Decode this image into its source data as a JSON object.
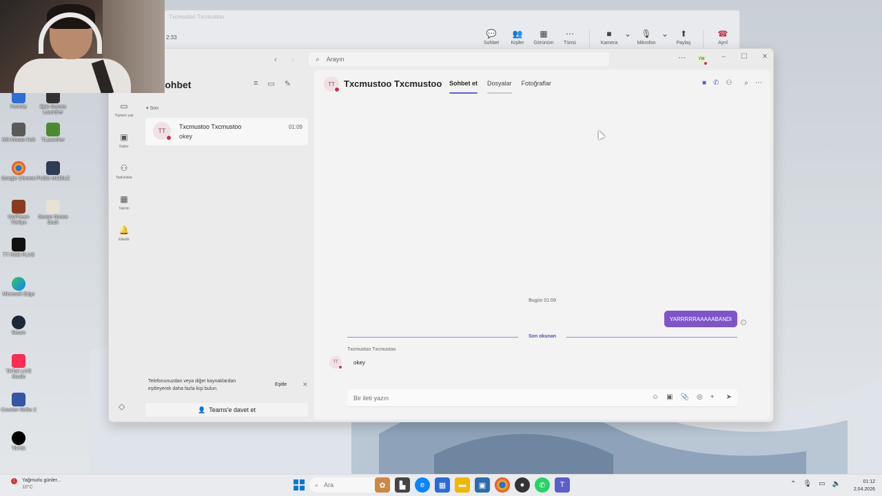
{
  "meeting_window": {
    "title": "Txcmustoo Txcmustoo",
    "time": "2:33",
    "toolbar": [
      {
        "label": "Sohbet",
        "icon": "chat-icon"
      },
      {
        "label": "Kişiler",
        "icon": "people-icon",
        "count": "2"
      },
      {
        "label": "Görünüm",
        "icon": "grid-icon"
      },
      {
        "label": "Tümü",
        "icon": "more-icon"
      },
      {
        "label": "Kamera",
        "icon": "camera-icon"
      },
      {
        "label": "Mikrofon",
        "icon": "mic-icon"
      },
      {
        "label": "Paylaş",
        "icon": "share-icon"
      },
      {
        "label": "Ayrıl",
        "icon": "hangup-icon"
      }
    ]
  },
  "desktop_icons": [
    {
      "label": "Fortnite"
    },
    {
      "label": "Epic Games Launcher"
    },
    {
      "label": "MS Mouse Hub"
    },
    {
      "label": "TLauncher"
    },
    {
      "label": "Google Chrome"
    },
    {
      "label": "PUBG MOBILE"
    },
    {
      "label": "WolfTeam Türkiye"
    },
    {
      "label": "Goose Goose Duck"
    },
    {
      "label": "TT RGB PLUS"
    },
    {
      "label": "Microsoft Edge"
    },
    {
      "label": "Steam"
    },
    {
      "label": "TikTok LIVE Studio"
    },
    {
      "label": "Counter-Strike 2"
    },
    {
      "label": "TikTok"
    }
  ],
  "teams": {
    "search_placeholder": "Arayın",
    "user_initials": "YM",
    "rail": [
      {
        "label": "Toplantı yap",
        "icon": "video-icon"
      },
      {
        "label": "Kişiler",
        "icon": "contacts-icon"
      },
      {
        "label": "Topluluklar",
        "icon": "communities-icon"
      },
      {
        "label": "Takvim",
        "icon": "calendar-icon"
      },
      {
        "label": "Etkinlik",
        "icon": "bell-icon"
      }
    ],
    "list_title": "Sohbet",
    "section_label": "Son",
    "chats": [
      {
        "initials": "TT",
        "name": "Txcmustoo Txcmustoo",
        "preview": "okey",
        "time": "01:09"
      }
    ],
    "sync_card": {
      "text": "Telefonunuzdan veya diğer kaynaklardan eşitleyerek daha fazla kişi bulun.",
      "button": "Eşitle"
    },
    "invite_button": "Teams'e davet et",
    "conversation": {
      "initials": "TT",
      "title": "Txcmustoo Txcmustoo",
      "tabs": [
        "Sohbet et",
        "Dosyalar",
        "Fotoğraflar"
      ],
      "date_separator": "Bugün 01:09",
      "sent_message": "YARRRRRAAAAABANDI",
      "last_read_label": "Son okunan",
      "reply_sender": "Txcmustoo Txcmustoo",
      "reply_initials": "TT",
      "reply_text": "okey",
      "composer_placeholder": "Bir ileti yazın"
    }
  },
  "taskbar": {
    "weather_title": "Yağmurlu günler...",
    "weather_temp": "10°C",
    "search_placeholder": "Ara",
    "time": "01:12",
    "date": "2.04.2026"
  }
}
